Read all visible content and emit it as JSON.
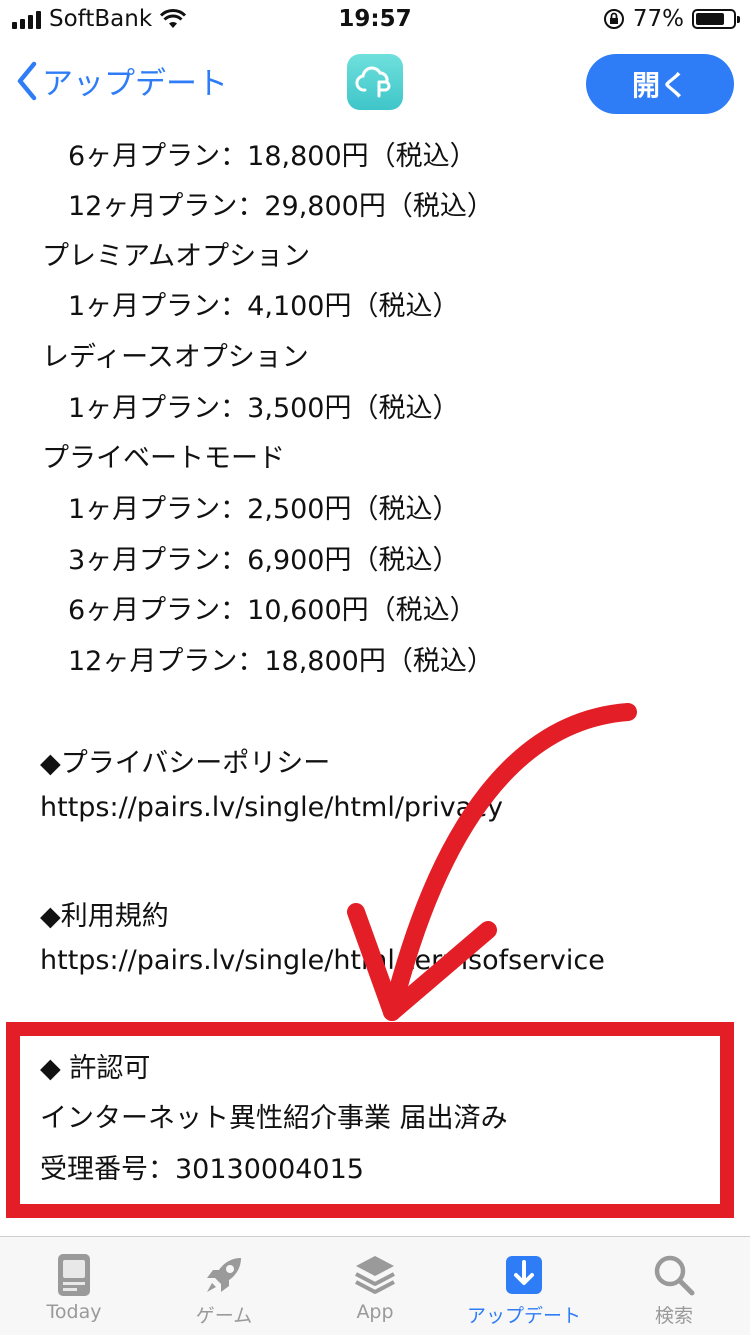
{
  "status": {
    "carrier": "SoftBank",
    "time": "19:57",
    "battery": "77%",
    "battery_level": 0.77
  },
  "nav": {
    "back_label": "アップデート",
    "open_label": "開く"
  },
  "content": {
    "lines": [
      "6ヶ月プラン：18,800円（税込）",
      "12ヶ月プラン：29,800円（税込）",
      "プレミアムオプション",
      "1ヶ月プラン：4,100円（税込）",
      "レディースオプション",
      "1ヶ月プラン：3,500円（税込）",
      "プライベートモード",
      "1ヶ月プラン：2,500円（税込）",
      "3ヶ月プラン：6,900円（税込）",
      "6ヶ月プラン：10,600円（税込）",
      "12ヶ月プラン：18,800円（税込）"
    ],
    "privacy_heading": "◆プライバシーポリシー",
    "privacy_url": "https://pairs.lv/single/html/privacy",
    "terms_heading": "◆利用規約",
    "terms_url": "https://pairs.lv/single/html/termsofservice",
    "license_heading": "◆ 許認可",
    "license_text": "インターネット異性紹介事業 届出済み",
    "license_number": "受理番号：30130004015"
  },
  "tabs": [
    {
      "label": "Today",
      "icon": "today-icon"
    },
    {
      "label": "ゲーム",
      "icon": "rocket-icon"
    },
    {
      "label": "App",
      "icon": "layers-icon"
    },
    {
      "label": "アップデート",
      "icon": "download-icon",
      "active": true
    },
    {
      "label": "検索",
      "icon": "search-icon"
    }
  ],
  "colors": {
    "accent": "#2f7df6",
    "annotation": "#e41e26"
  }
}
